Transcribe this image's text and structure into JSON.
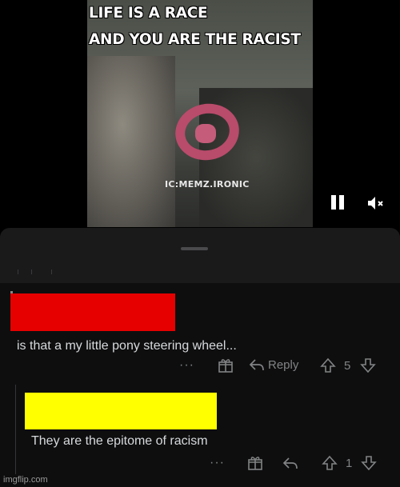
{
  "video": {
    "caption_line1": "LIFE IS A RACE",
    "caption_line2": "AND YOU ARE THE RACIST",
    "watermark": "IC:MEMZ.IRONIC",
    "controls": {
      "pause_icon": "pause-icon",
      "mute_icon": "speaker-muted-icon"
    }
  },
  "comments": [
    {
      "text": "is that a my little pony steering wheel...",
      "more": "···",
      "reply_label": "Reply",
      "score": "5"
    },
    {
      "text": "They are the epitome of racism",
      "more": "···",
      "score": "1"
    }
  ],
  "redaction_colors": {
    "first": "#e60000",
    "second": "#ffff00"
  },
  "footer": {
    "credit": "imgflip.com"
  }
}
